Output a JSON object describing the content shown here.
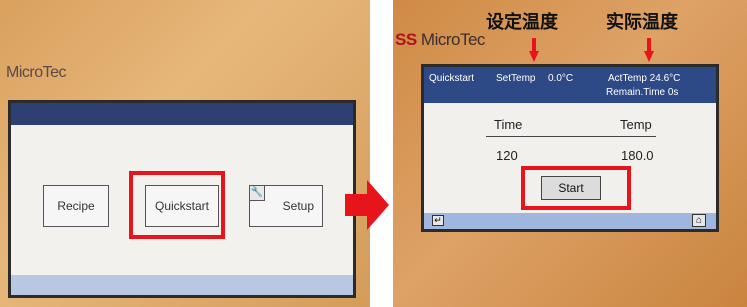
{
  "left_panel": {
    "brand": "MicroTec",
    "buttons": {
      "recipe": "Recipe",
      "quickstart": "Quickstart",
      "setup": "Setup"
    },
    "icons": {
      "setup_icon": "wrench-icon"
    }
  },
  "arrow": {
    "icon": "right-arrow-icon",
    "color": "#e8141c"
  },
  "right_panel": {
    "brand_prefix": "SS",
    "brand_name": "MicroTec",
    "annotations": {
      "set_temp_cn": "设定温度",
      "act_temp_cn": "实际温度"
    },
    "status_bar": {
      "mode": "Quickstart",
      "set_temp_label": "SetTemp",
      "set_temp_value": "0.0°C",
      "act_temp": "ActTemp 24.6°C",
      "remain_time": "Remain.Time 0s"
    },
    "table": {
      "headers": [
        "Time",
        "Temp"
      ],
      "values": [
        "120",
        "180.0"
      ]
    },
    "start_label": "Start",
    "icons": {
      "back": "back-icon",
      "home": "home-icon"
    }
  },
  "colors": {
    "highlight": "#e8141c",
    "status_bar": "#2e4a86",
    "footer": "#9fb6de"
  }
}
